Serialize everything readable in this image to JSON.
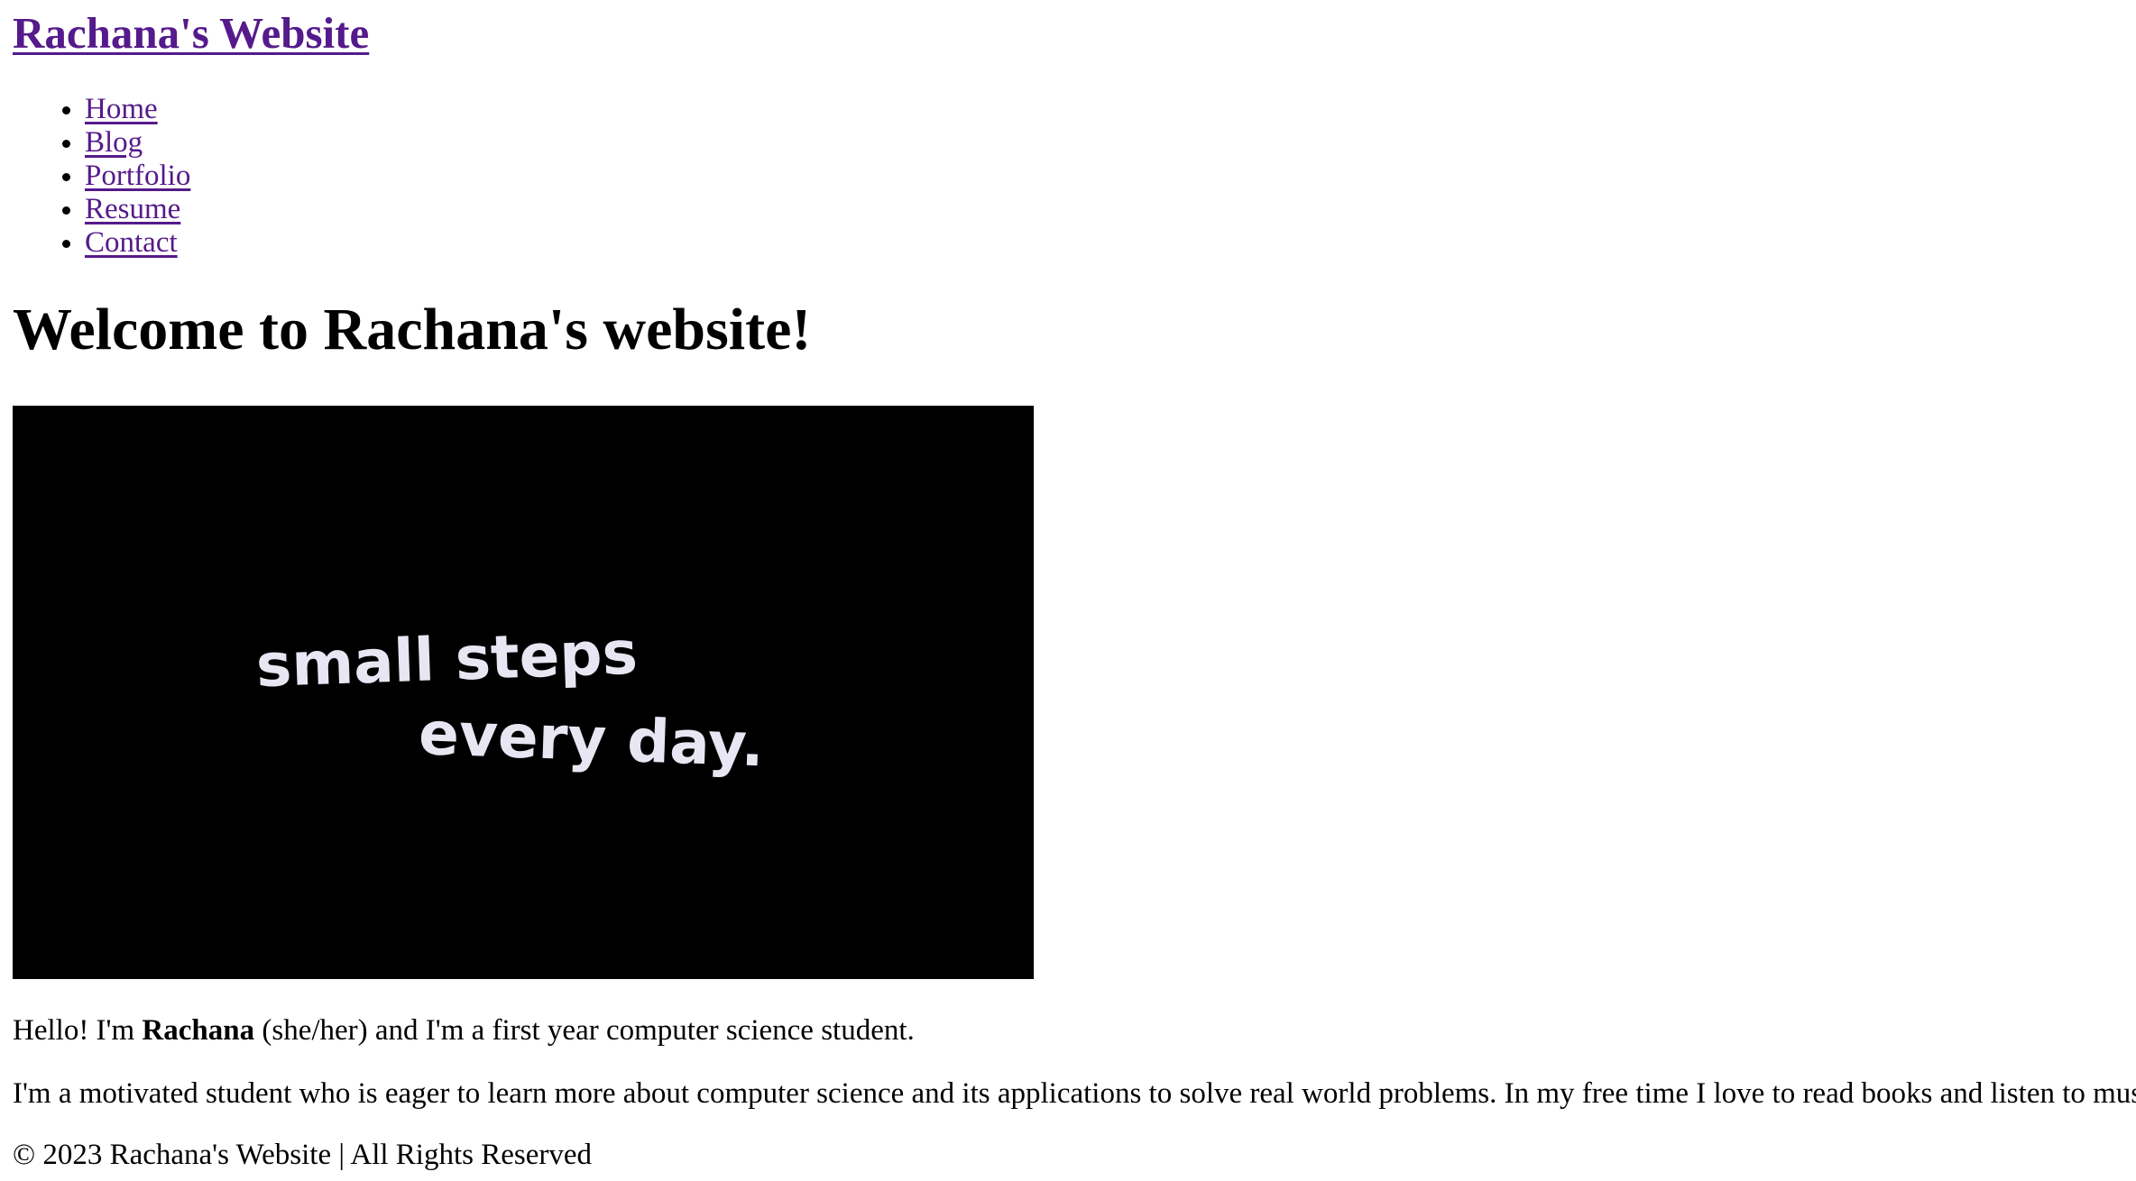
{
  "header": {
    "site_title": "Rachana's Website"
  },
  "nav": {
    "items": [
      {
        "label": "Home"
      },
      {
        "label": "Blog"
      },
      {
        "label": "Portfolio"
      },
      {
        "label": "Resume"
      },
      {
        "label": "Contact"
      }
    ]
  },
  "main": {
    "heading": "Welcome to Rachana's website!",
    "hero_image": {
      "line1": "small steps",
      "line2": "every day."
    },
    "intro": {
      "prefix": "Hello! I'm ",
      "name": "Rachana",
      "suffix": " (she/her) and I'm a first year computer science student."
    },
    "about": "I'm a motivated student who is eager to learn more about computer science and its applications to solve real world problems. In my free time I love to read books and listen to music!"
  },
  "footer": {
    "text": "© 2023 Rachana's Website | All Rights Reserved"
  },
  "colors": {
    "link": "#551a8b",
    "text": "#000000",
    "hero_background": "#000000",
    "hero_text": "#e8e6f2"
  }
}
